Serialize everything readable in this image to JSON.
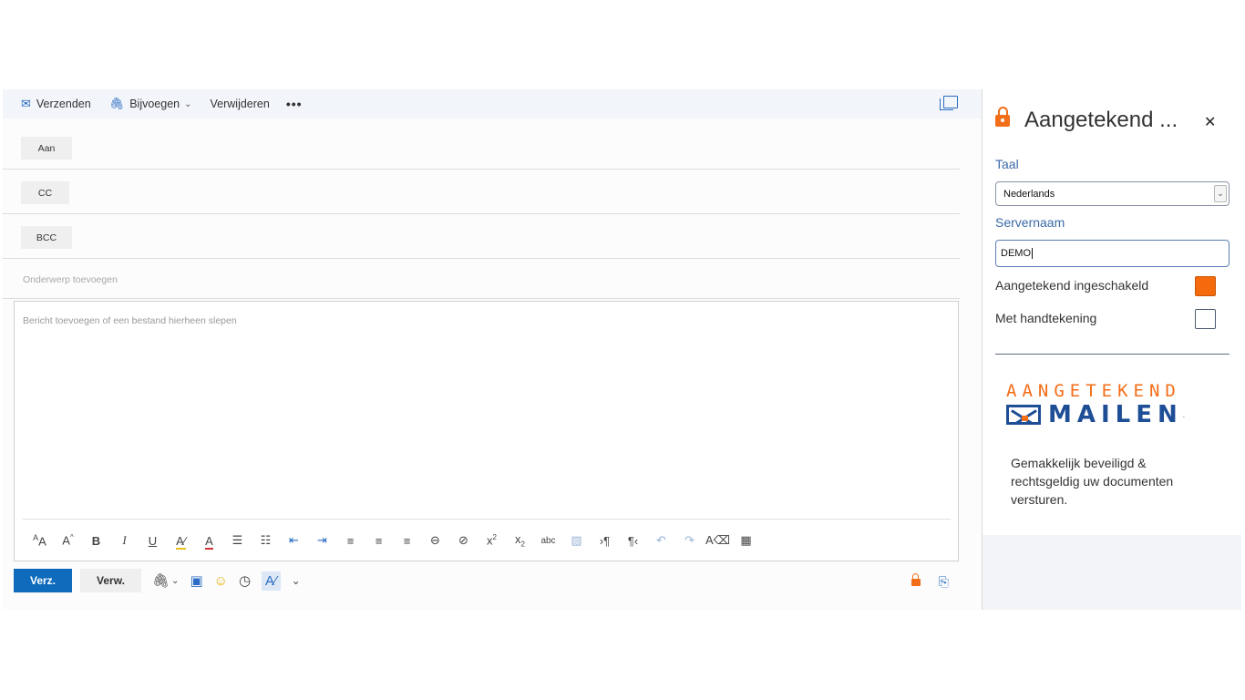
{
  "toolbar": {
    "send_label": "Verzenden",
    "attach_label": "Bijvoegen",
    "delete_label": "Verwijderen",
    "more_label": "•••"
  },
  "recipients": {
    "to_label": "Aan",
    "cc_label": "CC",
    "bcc_label": "BCC"
  },
  "subject": {
    "placeholder": "Onderwerp toevoegen"
  },
  "body": {
    "placeholder": "Bericht toevoegen of een bestand hierheen slepen"
  },
  "format_toolbar": {
    "icons": [
      "font-size-icon",
      "font-grow-icon",
      "bold-icon",
      "italic-icon",
      "underline-icon",
      "highlight-icon",
      "font-color-icon",
      "bullets-icon",
      "numbering-icon",
      "decrease-indent-icon",
      "increase-indent-icon",
      "align-left-icon",
      "align-center-icon",
      "align-right-icon",
      "link-icon",
      "remove-link-icon",
      "superscript-icon",
      "subscript-icon",
      "strikethrough-icon",
      "image-icon",
      "ltr-icon",
      "rtl-icon",
      "undo-icon",
      "redo-icon",
      "clear-format-icon",
      "table-icon"
    ]
  },
  "actions": {
    "send_label": "Verz.",
    "discard_label": "Verw."
  },
  "addin": {
    "title": "Aangetekend ...",
    "language_label": "Taal",
    "language_value": "Nederlands",
    "server_label": "Servernaam",
    "server_value": "DEMO",
    "registered_label": "Aangetekend ingeschakeld",
    "registered_checked": true,
    "signature_label": "Met handtekening",
    "signature_checked": false,
    "logo_top": "AANGETEKEND",
    "logo_bottom": "MAILEN",
    "logo_reg": ".",
    "tagline": "Gemakkelijk beveiligd & rechtsgeldig uw documenten versturen."
  },
  "colors": {
    "accent": "#0f6cbd",
    "brand_orange": "#f36e19",
    "brand_blue": "#1d4e96"
  }
}
